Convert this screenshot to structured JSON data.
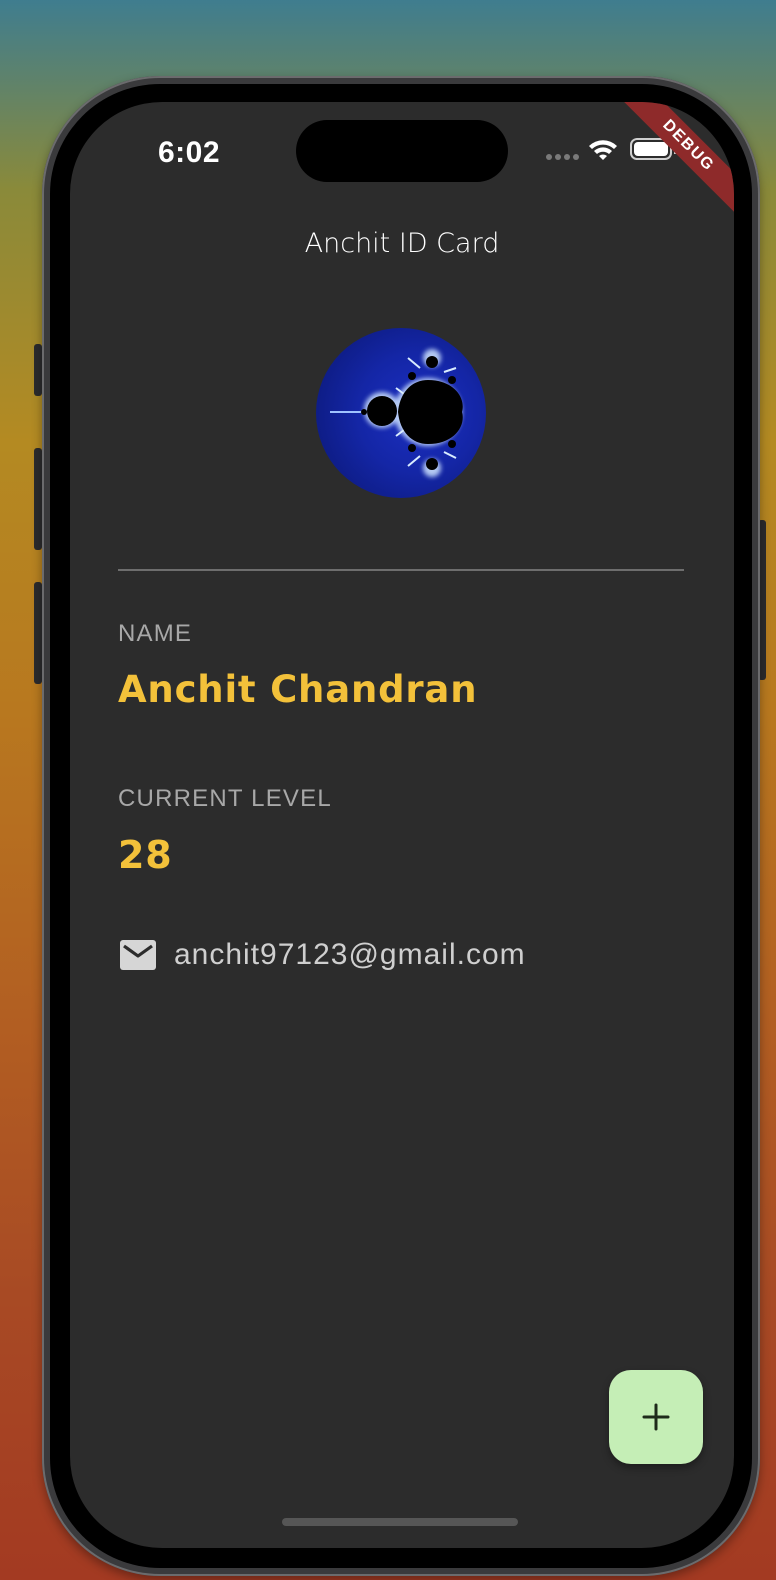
{
  "status_bar": {
    "time": "6:02"
  },
  "debug_banner": {
    "label": "DEBUG"
  },
  "app_bar": {
    "title": "Anchit ID Card"
  },
  "profile": {
    "name_label": "NAME",
    "name_value": "Anchit Chandran",
    "level_label": "CURRENT LEVEL",
    "level_value": "28",
    "email": "anchit97123@gmail.com"
  },
  "fab": {
    "icon": "plus-icon"
  },
  "colors": {
    "background": "#2c2c2c",
    "accent": "#f3c13a",
    "fab": "#c5eeb6",
    "label": "#a8a8a8"
  }
}
